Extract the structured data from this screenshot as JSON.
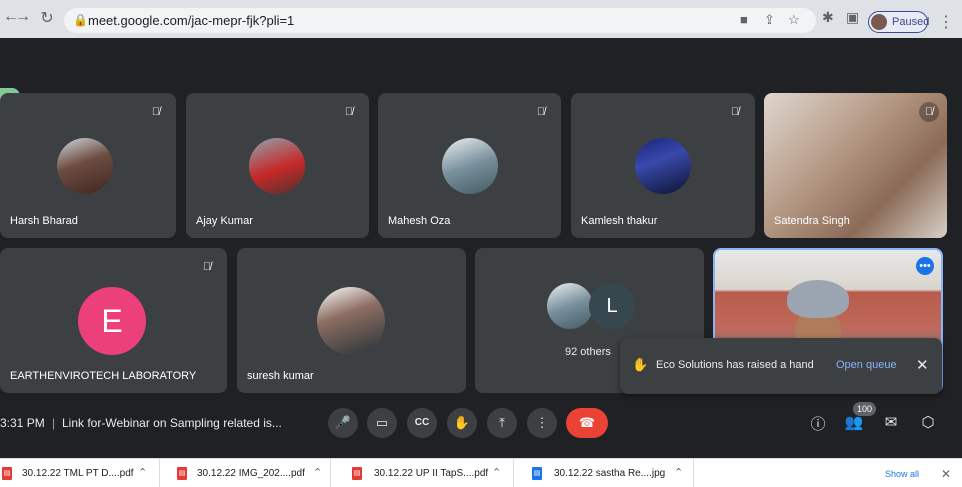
{
  "browser": {
    "url": "meet.google.com/jac-mepr-fjk?pli=1",
    "profile_status": "Paused",
    "icons": [
      "back-icon",
      "forward-icon",
      "reload-icon",
      "lock-icon",
      "camera-blocked-icon",
      "share-icon",
      "star-icon",
      "extensions-icon",
      "sidepanel-icon",
      "menu-icon"
    ]
  },
  "tiles_row1": [
    {
      "name": "Harsh Bharad",
      "muted": true
    },
    {
      "name": "Ajay Kumar",
      "muted": true
    },
    {
      "name": "Mahesh Oza",
      "muted": true
    },
    {
      "name": "Kamlesh thakur",
      "muted": true
    },
    {
      "name": "Satendra Singh",
      "muted": true,
      "video": true
    }
  ],
  "tiles_row2": [
    {
      "name": "EARTHENVIROTECH LABORATORY",
      "avatar_letter": "E",
      "avatar_color": "#ec407a",
      "muted": true
    },
    {
      "name": "suresh kumar",
      "muted": false
    },
    {
      "others_label": "92 others",
      "avatar_letter": "L",
      "avatar_color": "#37474f"
    },
    {
      "name": "",
      "video": true,
      "active": true
    }
  ],
  "toast": {
    "message": "Eco Solutions has raised a hand",
    "action": "Open queue"
  },
  "controls": {
    "time": "3:31 PM",
    "meeting_title": "Link for-Webinar on Sampling related is...",
    "participant_count": "100"
  },
  "downloads": [
    {
      "file": "30.12.22 TML PT D....pdf",
      "type": "pdf"
    },
    {
      "file": "30.12.22 IMG_202....pdf",
      "type": "pdf"
    },
    {
      "file": "30.12.22 UP II TapS....pdf",
      "type": "pdf"
    },
    {
      "file": "30.12.22 sastha Re....jpg",
      "type": "jpg"
    }
  ],
  "shelf": {
    "show_all": "Show all"
  },
  "colors": {
    "accent": "#8ab4f8",
    "end_call": "#ea4335",
    "tile": "#3c4043",
    "background": "#202124"
  }
}
